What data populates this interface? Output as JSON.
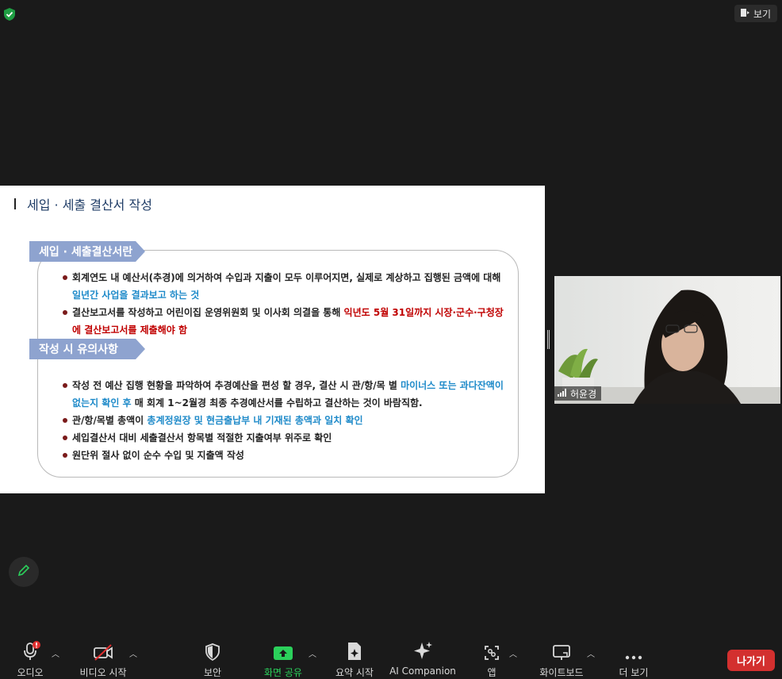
{
  "top": {
    "view_label": "보기"
  },
  "slide": {
    "title": "세입 · 세출 결산서 작성",
    "section1": {
      "tab": "세입 · 세출결산서란",
      "b1_a": "회계연도 내 예산서(추경)에 의거하여 수입과 지출이 모두 이루어지면, 실제로 계상하고 집행된 금액에 대해 ",
      "b1_b": "일년간 사업을 결과보고 하는 것",
      "b2_a": "결산보고서를 작성하고 어린이집 운영위원회 및 이사회 의결을 통해 ",
      "b2_b": "익년도 5월 31일까지 시장·군수·구청장에 결산보고서를 제출해야 함"
    },
    "section2": {
      "tab": "작성 시 유의사항",
      "b1_a": "작성 전 예산 집행 현황을 파악하여 추경예산을 편성 할 경우, 결산 시 관/항/목 별 ",
      "b1_b": "마이너스 또는 과다잔액이 없는지 확인 후",
      "b1_c": " 매 회계 1~2월경 최종 추경예산서를 수립하고 결산하는 것이 바람직함.",
      "b2_a": "관/항/목별 총액이 ",
      "b2_b": "총계정원장 및 현금출납부 내 기재된 총액과 일치 확인",
      "b3": "세입결산서 대비 세출결산서 항목별 적절한 지출여부 위주로 확인",
      "b4": "원단위 절사 없이 순수 수입 및 지출액 작성"
    }
  },
  "participant": {
    "name": "허윤경"
  },
  "toolbar": {
    "audio": "오디오",
    "video": "비디오 시작",
    "security": "보안",
    "share": "화면 공유",
    "summary": "요약 시작",
    "ai": "AI Companion",
    "apps": "앱",
    "whiteboard": "화이트보드",
    "more": "더 보기",
    "leave": "나가기"
  },
  "colors": {
    "share_green": "#2bd05b",
    "leave_red": "#d3302f",
    "slide_tab": "#8ea3cf",
    "highlight_blue": "#1e8ac9",
    "highlight_red": "#c00000"
  }
}
